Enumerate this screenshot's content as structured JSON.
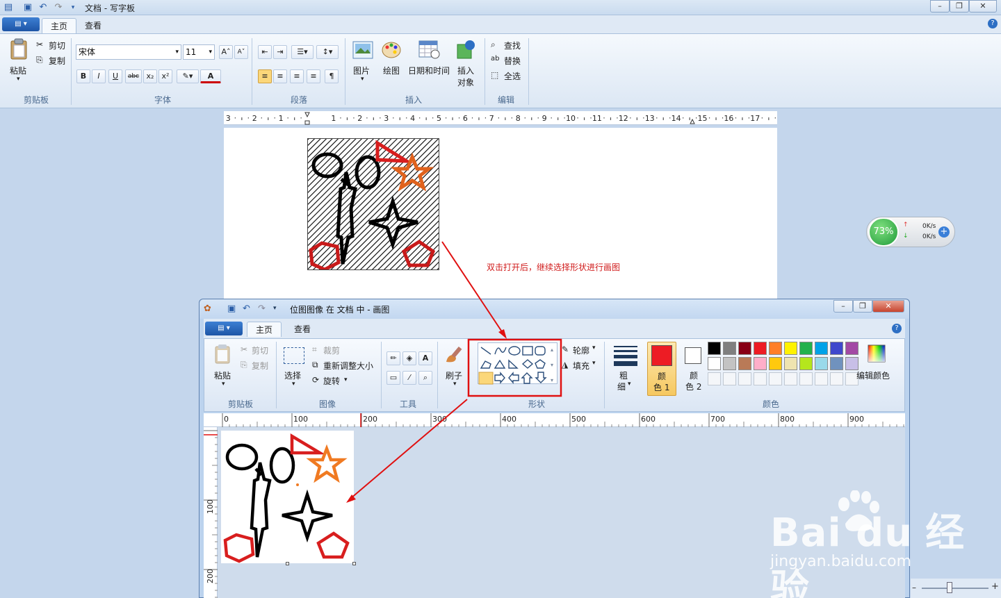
{
  "wordpad": {
    "title": "文档 - 写字板",
    "tabs": [
      "主页",
      "查看"
    ],
    "clipboard": {
      "paste": "粘贴",
      "cut": "剪切",
      "copy": "复制",
      "label": "剪贴板"
    },
    "font": {
      "name": "宋体",
      "size": "11",
      "label": "字体",
      "bold": "B",
      "italic": "I",
      "underline": "U",
      "strike": "abc",
      "sub": "x₂",
      "sup": "x²",
      "grow": "A˄",
      "shrink": "A˅",
      "color": "A"
    },
    "paragraph": {
      "label": "段落"
    },
    "insert": {
      "picture": "图片",
      "paint": "绘图",
      "datetime": "日期和时间",
      "object1": "插入",
      "object2": "对象",
      "label": "插入"
    },
    "edit": {
      "find": "查找",
      "replace": "替换",
      "select_all": "全选",
      "label": "编辑"
    },
    "ruler": [
      "3",
      "2",
      "1",
      "1",
      "2",
      "3",
      "4",
      "5",
      "6",
      "7",
      "8",
      "9",
      "10",
      "11",
      "12",
      "13",
      "14",
      "15",
      "16",
      "17"
    ]
  },
  "net_monitor": {
    "percent": "73%",
    "up": "0K/s",
    "down": "0K/s"
  },
  "annotation": "双击打开后，继续选择形状进行画图",
  "paint": {
    "title": "位图图像 在 文档 中 - 画图",
    "tabs": [
      "主页",
      "查看"
    ],
    "clipboard": {
      "paste": "粘贴",
      "cut": "剪切",
      "copy": "复制",
      "label": "剪贴板"
    },
    "image": {
      "select": "选择",
      "crop": "裁剪",
      "resize": "重新调整大小",
      "rotate": "旋转",
      "label": "图像"
    },
    "tools": {
      "label": "工具"
    },
    "brush": "刷子",
    "shapes": {
      "outline": "轮廓",
      "fill": "填充",
      "label": "形状"
    },
    "size": {
      "line1": "粗",
      "line2": "细"
    },
    "color1": {
      "line1": "颜",
      "line2": "色 1"
    },
    "color2": {
      "line1": "颜",
      "line2": "色 2"
    },
    "colors_label": "颜色",
    "edit_colors": "编辑颜色",
    "hruler": [
      "0",
      "100",
      "200",
      "300",
      "400",
      "500",
      "600",
      "700",
      "800",
      "900"
    ],
    "vruler": [
      "100",
      "200"
    ],
    "palette": [
      "#000000",
      "#7f7f7f",
      "#880015",
      "#ed1c24",
      "#ff7f27",
      "#fff200",
      "#22b14c",
      "#00a2e8",
      "#3f48cc",
      "#a349a4",
      "#ffffff",
      "#c3c3c3",
      "#b97a57",
      "#ffaec9",
      "#ffc90e",
      "#efe4b0",
      "#b5e61d",
      "#99d9ea",
      "#7092be",
      "#c8bfe7"
    ],
    "color1_value": "#ed1c24",
    "color2_value": "#ffffff"
  },
  "watermark": {
    "brand": "Bai  du",
    "brand_cn": "经验",
    "url": "jingyan.baidu.com"
  }
}
